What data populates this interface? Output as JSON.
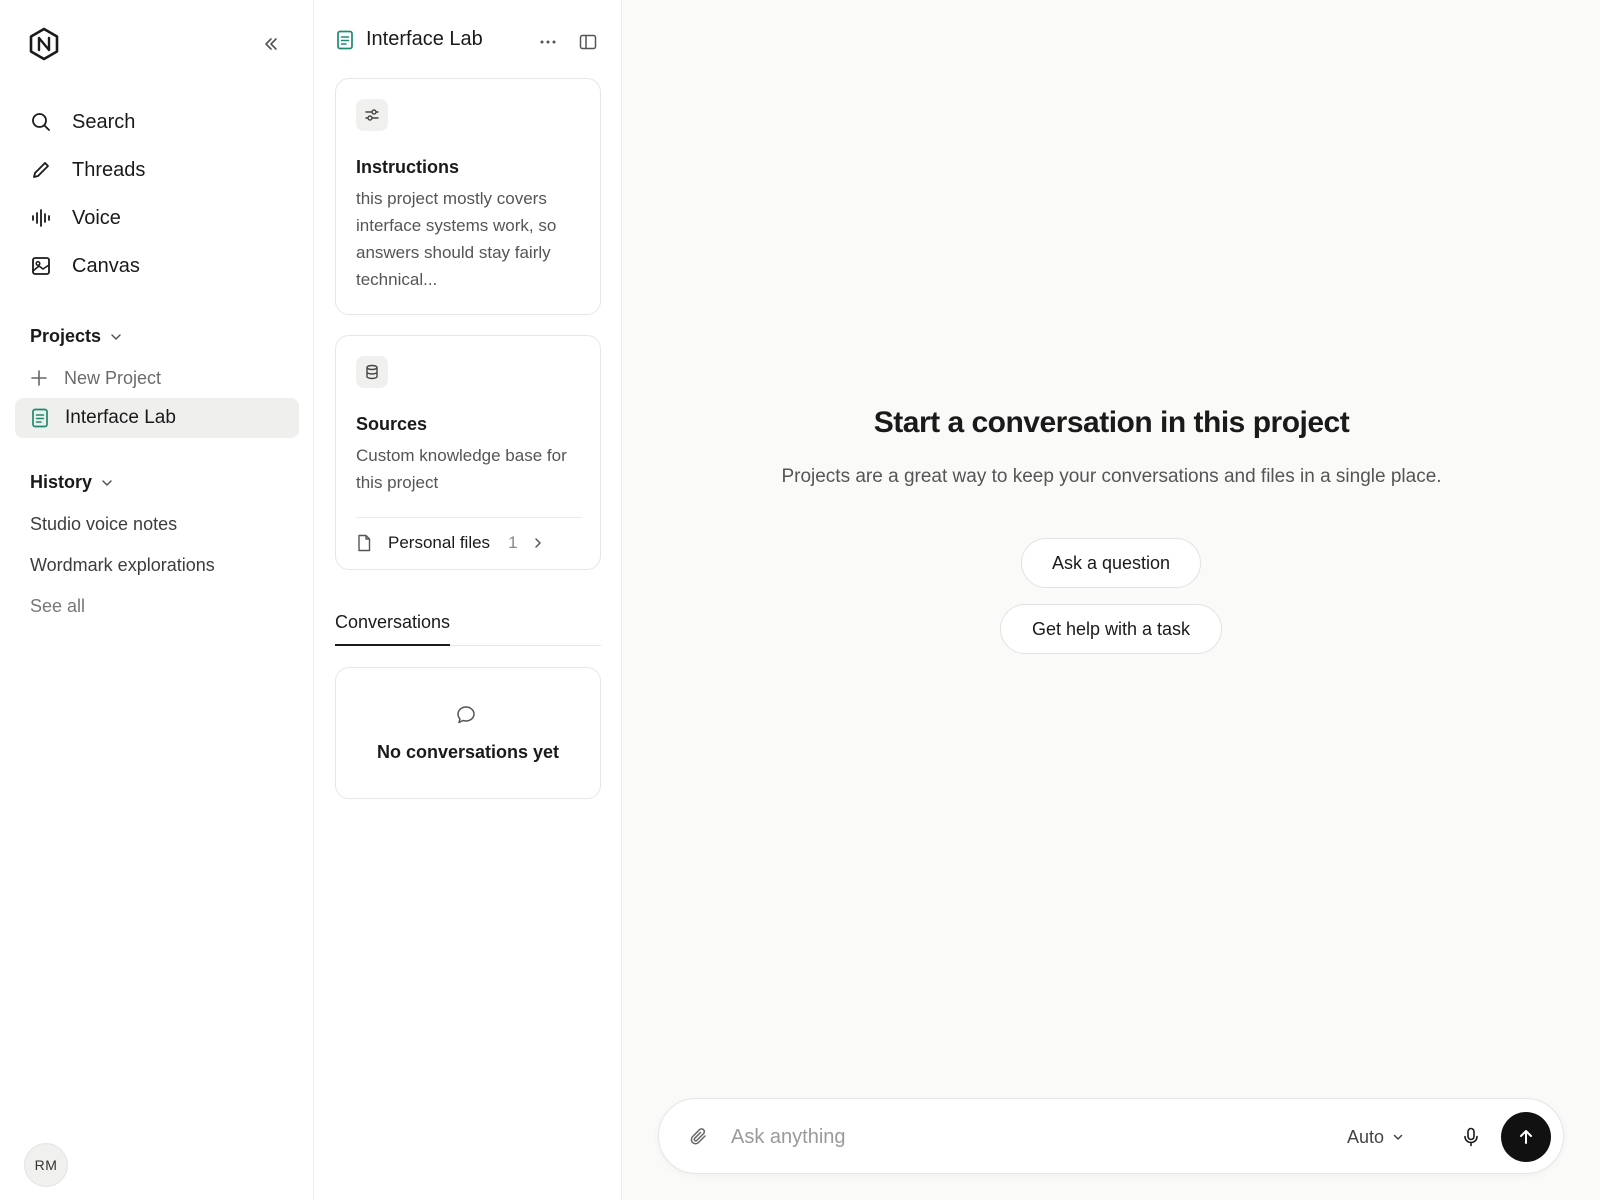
{
  "app": {
    "logo_icon": "hexagon-n-logo",
    "colors": {
      "accent": "#1f8a70",
      "primary_button": "#111111",
      "selected_bg": "#efefee"
    }
  },
  "sidebar": {
    "nav": [
      {
        "label": "Search",
        "icon": "search-icon"
      },
      {
        "label": "Threads",
        "icon": "pencil-icon"
      },
      {
        "label": "Voice",
        "icon": "waveform-icon"
      },
      {
        "label": "Canvas",
        "icon": "image-icon"
      }
    ],
    "projects": {
      "heading": "Projects",
      "new_label": "New Project",
      "items": [
        {
          "label": "Interface Lab",
          "selected": true
        }
      ]
    },
    "history": {
      "heading": "History",
      "items": [
        "Studio voice notes",
        "Wordmark explorations"
      ],
      "see_all": "See all"
    },
    "user_initials": "RM"
  },
  "project_panel": {
    "title": "Interface Lab",
    "instructions": {
      "title": "Instructions",
      "text": "this project mostly covers interface systems work, so answers should stay fairly technical..."
    },
    "sources": {
      "title": "Sources",
      "text": "Custom knowledge base for this project",
      "files_label": "Personal files",
      "files_count": "1"
    },
    "tabs": [
      "Conversations"
    ],
    "empty_state": "No conversations yet"
  },
  "main": {
    "title": "Start a conversation in this project",
    "subtitle": "Projects are a great way to keep your conversations and files in a single place.",
    "suggestions": [
      "Ask a question",
      "Get help with a task"
    ],
    "composer": {
      "placeholder": "Ask anything",
      "mode": "Auto"
    }
  }
}
